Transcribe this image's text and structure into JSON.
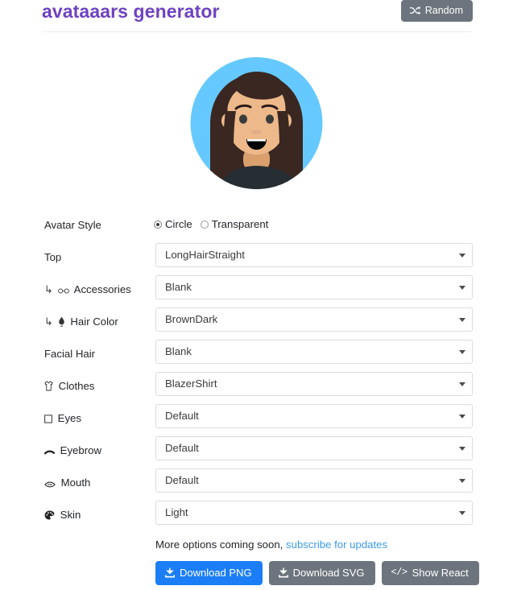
{
  "header": {
    "title": "avataaars generator",
    "random_button": {
      "label": "Random",
      "icon": "shuffle-icon"
    }
  },
  "avatar": {
    "alt": "avatar-preview",
    "style": "Circle",
    "colors": {
      "background": "#65c9ff",
      "hair": "#3a2721",
      "skin": "#edb98a",
      "clothes": "#262e33",
      "clothes_detail": "#ffffff",
      "eyes": "#2c1b18",
      "mouth": "#000000"
    }
  },
  "form": {
    "avatar_style": {
      "label": "Avatar Style",
      "options": [
        {
          "label": "Circle",
          "selected": true
        },
        {
          "label": "Transparent",
          "selected": false
        }
      ]
    },
    "rows": [
      {
        "label": "Top",
        "lead": "",
        "icon": "",
        "value": "LongHairStraight"
      },
      {
        "label": "Accessories",
        "lead": "↳",
        "icon": "glasses-icon",
        "value": "Blank"
      },
      {
        "label": "Hair Color",
        "lead": "↳",
        "icon": "hair-dye-icon",
        "value": "BrownDark"
      },
      {
        "label": "Facial Hair",
        "lead": "",
        "icon": "",
        "value": "Blank"
      },
      {
        "label": "Clothes",
        "lead": "",
        "icon": "tshirt-icon",
        "value": "BlazerShirt"
      },
      {
        "label": "Eyes",
        "lead": "",
        "icon": "eyes-icon",
        "value": "Default"
      },
      {
        "label": "Eyebrow",
        "lead": "",
        "icon": "eyebrow-icon",
        "value": "Default"
      },
      {
        "label": "Mouth",
        "lead": "",
        "icon": "mouth-icon",
        "value": "Default"
      },
      {
        "label": "Skin",
        "lead": "",
        "icon": "palette-icon",
        "value": "Light"
      }
    ]
  },
  "footer": {
    "note_text": "More options coming soon,",
    "note_link": "subscribe for updates",
    "buttons": [
      {
        "label": "Download PNG",
        "icon": "download-icon",
        "style": "primary"
      },
      {
        "label": "Download SVG",
        "icon": "download-icon",
        "style": "secondary"
      },
      {
        "label": "Show React",
        "icon": "code-icon",
        "style": "secondary"
      }
    ]
  },
  "theme": {
    "accent_purple": "#6f42c1",
    "primary_blue": "#1b7ef7",
    "secondary_gray": "#6c757d",
    "link_blue": "#3d9ae8"
  }
}
